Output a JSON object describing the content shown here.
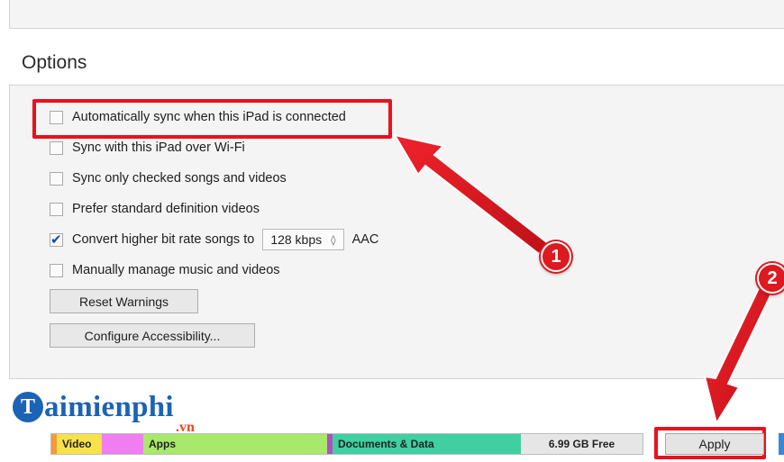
{
  "options": {
    "title": "Options",
    "items": [
      {
        "label": "Automatically sync when this iPad is connected",
        "checked": false
      },
      {
        "label": "Sync with this iPad over Wi-Fi",
        "checked": false
      },
      {
        "label": "Sync only checked songs and videos",
        "checked": false
      },
      {
        "label": "Prefer standard definition videos",
        "checked": false
      },
      {
        "label": "Convert higher bit rate songs to",
        "checked": true
      },
      {
        "label": "Manually manage music and videos",
        "checked": false
      }
    ],
    "bitrate": {
      "value": "128 kbps",
      "codec": "AAC"
    },
    "reset_warnings_label": "Reset Warnings",
    "configure_accessibility_label": "Configure Accessibility..."
  },
  "storage": {
    "segments": [
      {
        "label": "Video",
        "color": "#f7e24a"
      },
      {
        "label": "",
        "color": "#f07ef0"
      },
      {
        "label": "Apps",
        "color": "#a8e86a"
      },
      {
        "label": "Documents & Data",
        "color": "#3fcfa0"
      },
      {
        "label": "6.99 GB Free",
        "color": "#e6e6e6"
      }
    ]
  },
  "apply_label": "Apply",
  "annotations": {
    "step1": "1",
    "step2": "2",
    "highlight_color": "#e8121c"
  },
  "watermark": {
    "brand": "aimienphi",
    "brand_initial": "T",
    "suffix": ".vn"
  }
}
